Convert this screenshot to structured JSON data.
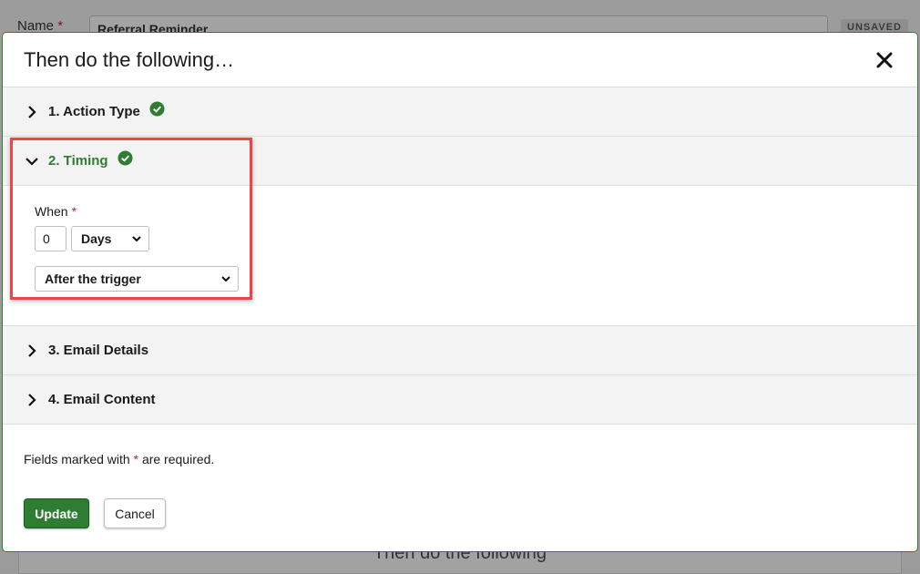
{
  "background": {
    "name_label": "Name",
    "required_mark": "*",
    "name_value": "Referral Reminder",
    "status_badge": "UNSAVED",
    "panel_title": "Then do the following"
  },
  "modal": {
    "title": "Then do the following…",
    "sections": [
      {
        "label": "1. Action Type",
        "expanded": false,
        "complete": true
      },
      {
        "label": "2. Timing",
        "expanded": true,
        "complete": true
      },
      {
        "label": "3. Email Details",
        "expanded": false,
        "complete": false
      },
      {
        "label": "4. Email Content",
        "expanded": false,
        "complete": false
      }
    ],
    "timing": {
      "when_label": "When",
      "required_mark": "*",
      "amount_value": "0",
      "unit_value": "Days",
      "relation_value": "After the trigger"
    },
    "footer": {
      "note_prefix": "Fields marked with",
      "required_mark": "*",
      "note_suffix": "are required.",
      "update_label": "Update",
      "cancel_label": "Cancel"
    }
  },
  "colors": {
    "accent_green": "#2e7d32",
    "required_red": "#c62828",
    "highlight_red": "#ef4444"
  }
}
